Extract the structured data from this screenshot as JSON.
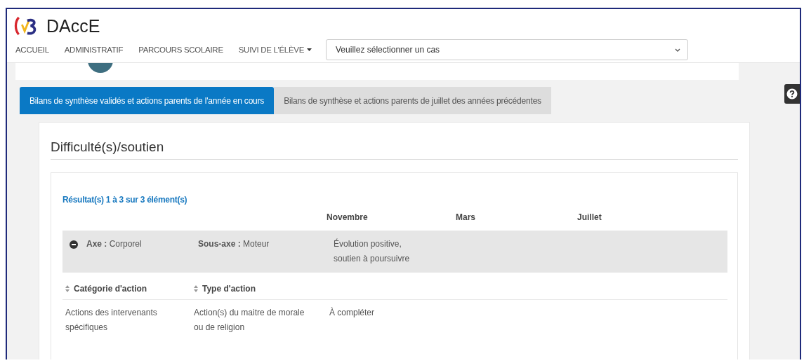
{
  "app": {
    "title": "DAccE"
  },
  "nav": {
    "items": [
      {
        "label": "ACCUEIL",
        "kind": "link"
      },
      {
        "label": "ADMINISTRATIF",
        "kind": "link"
      },
      {
        "label": "PARCOURS SCOLAIRE",
        "kind": "link"
      },
      {
        "label": "SUIVI DE L'ÉLÈVE",
        "kind": "dropdown"
      }
    ],
    "case_select": {
      "value": "Veuillez sélectionner un cas"
    }
  },
  "tabs": [
    {
      "label": "Bilans de synthèse validés et actions parents de l'année en cours",
      "selected": true
    },
    {
      "label": "Bilans de synthèse et actions parents de juillet des années précédentes",
      "selected": false
    }
  ],
  "section": {
    "title": "Difficulté(s)/soutien",
    "results": "Résultat(s) 1 à 3 sur 3 élément(s)",
    "months": [
      "Novembre",
      "Mars",
      "Juillet"
    ],
    "axis_rows": [
      {
        "expanded": true,
        "axe": "**Axe :** Corporel",
        "sous_axe": "**Sous-axe :** Moteur",
        "values": [
          "Évolution positive, soutien à poursuivre"
        ],
        "action_columns": [
          "Catégorie d'action",
          "Type d'action"
        ],
        "actions": [
          {
            "category": "Actions des intervenants spécifiques",
            "type": "Action(s) du maitre de morale ou de religion",
            "values": [
              "À compléter"
            ]
          }
        ]
      }
    ]
  }
}
